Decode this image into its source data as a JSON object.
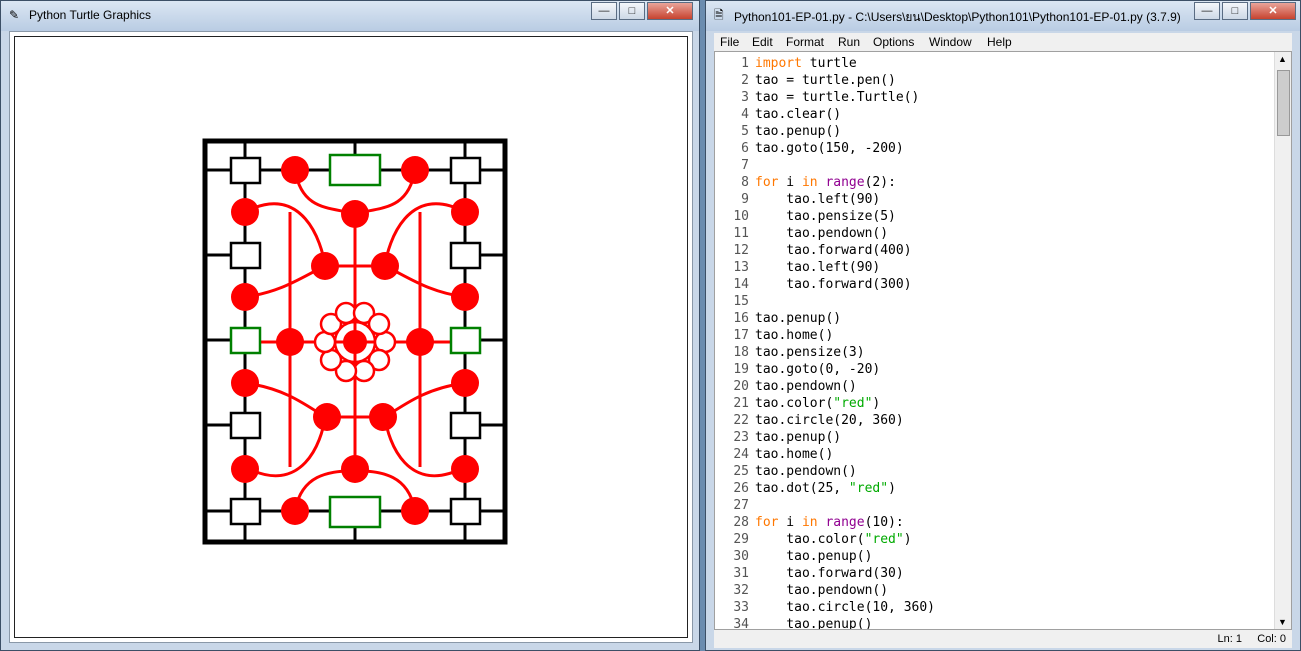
{
  "turtle_window": {
    "title": "Python Turtle Graphics",
    "controls": {
      "minimize": "—",
      "maximize": "□",
      "close": "✕"
    }
  },
  "idle_window": {
    "title": "Python101-EP-01.py - C:\\Users\\ยน\\Desktop\\Python101\\Python101-EP-01.py (3.7.9)",
    "controls": {
      "minimize": "—",
      "maximize": "□",
      "close": "✕"
    },
    "menu": [
      "File",
      "Edit",
      "Format",
      "Run",
      "Options",
      "Window",
      "Help"
    ],
    "lines": [
      "import turtle",
      "tao = turtle.pen()",
      "tao = turtle.Turtle()",
      "tao.clear()",
      "tao.penup()",
      "tao.goto(150, -200)",
      "",
      "for i in range(2):",
      "    tao.left(90)",
      "    tao.pensize(5)",
      "    tao.pendown()",
      "    tao.forward(400)",
      "    tao.left(90)",
      "    tao.forward(300)",
      "",
      "tao.penup()",
      "tao.home()",
      "tao.pensize(3)",
      "tao.goto(0, -20)",
      "tao.pendown()",
      "tao.color(\"red\")",
      "tao.circle(20, 360)",
      "tao.penup()",
      "tao.home()",
      "tao.pendown()",
      "tao.dot(25, \"red\")",
      "",
      "for i in range(10):",
      "    tao.color(\"red\")",
      "    tao.penup()",
      "    tao.forward(30)",
      "    tao.pendown()",
      "    tao.circle(10, 360)",
      "    tao.penup()"
    ],
    "status": {
      "ln": "Ln: 1",
      "col": "Col: 0"
    }
  },
  "colors": {
    "red": "#ff0000",
    "green": "#008000",
    "black": "#000000"
  }
}
